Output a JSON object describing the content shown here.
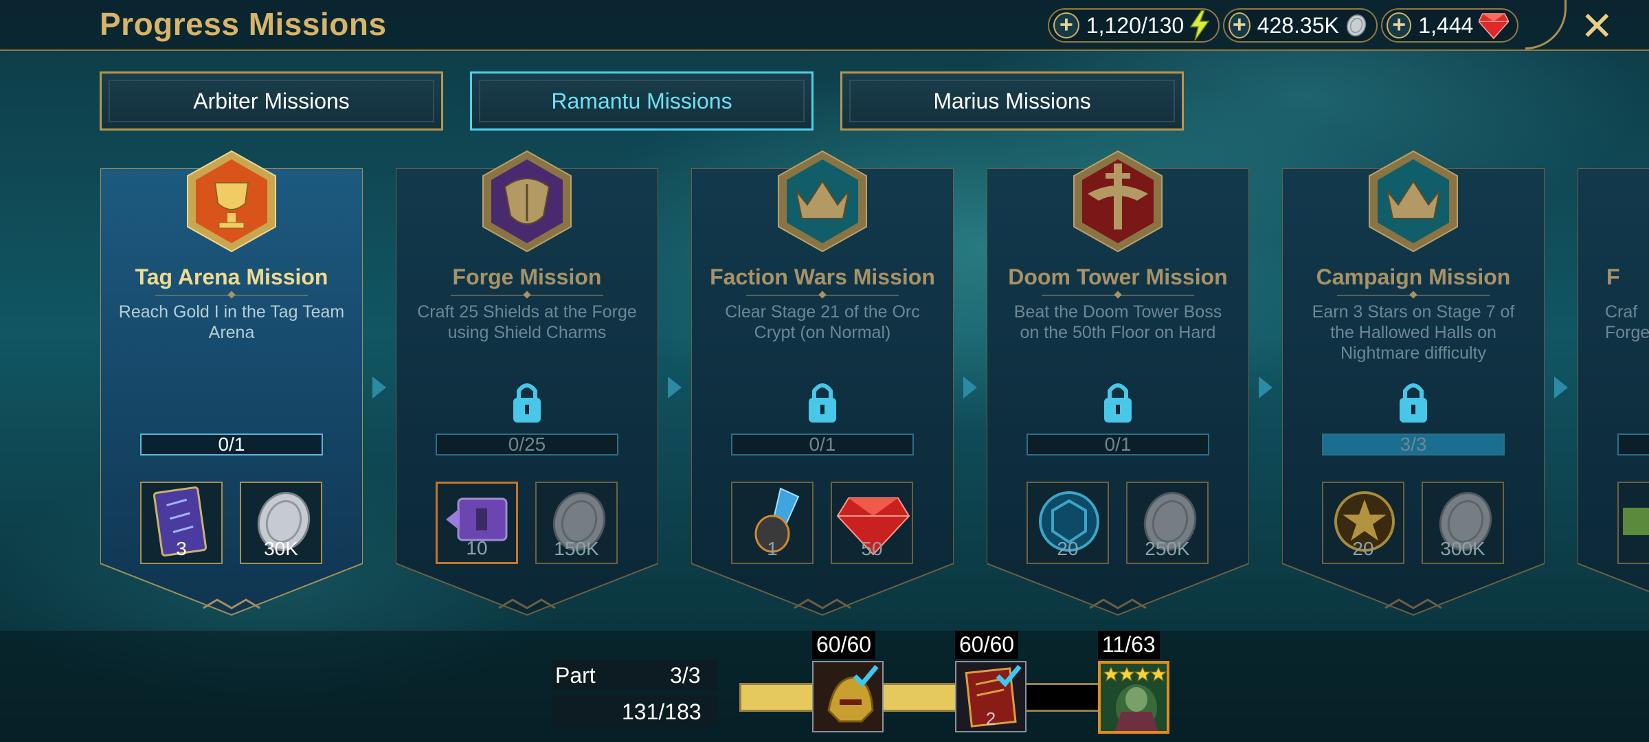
{
  "header": {
    "title": "Progress Missions",
    "currencies": [
      {
        "value": "1,120/130",
        "icon": "energy-icon"
      },
      {
        "value": "428.35K",
        "icon": "silver-icon"
      },
      {
        "value": "1,444",
        "icon": "gem-icon"
      }
    ],
    "close_icon": "close-icon"
  },
  "tabs": [
    {
      "label": "Arbiter Missions",
      "active": false
    },
    {
      "label": "Ramantu Missions",
      "active": true
    },
    {
      "label": "Marius Missions",
      "active": false
    }
  ],
  "missions": [
    {
      "title": "Tag Arena Mission",
      "desc": "Reach Gold I in the Tag Team Arena",
      "progress": "0/1",
      "fill": 0,
      "locked": false,
      "active": true,
      "rewards": [
        {
          "icon": "tome-icon",
          "qty": "3"
        },
        {
          "icon": "silver-icon",
          "qty": "30K"
        }
      ]
    },
    {
      "title": "Forge Mission",
      "desc": "Craft 25 Shields at the Forge using Shield Charms",
      "progress": "0/25",
      "fill": 0,
      "locked": true,
      "active": false,
      "rewards": [
        {
          "icon": "shield-artifact-icon",
          "qty": "10"
        },
        {
          "icon": "silver-icon",
          "qty": "150K"
        }
      ]
    },
    {
      "title": "Faction Wars Mission",
      "desc": "Clear Stage 21 of the Orc Crypt (on Normal)",
      "progress": "0/1",
      "fill": 0,
      "locked": true,
      "active": false,
      "rewards": [
        {
          "icon": "crystal-helmet-icon",
          "qty": "1"
        },
        {
          "icon": "gem-icon",
          "qty": "50"
        }
      ]
    },
    {
      "title": "Doom Tower Mission",
      "desc": "Beat the Doom Tower Boss on the 50th Floor on Hard",
      "progress": "0/1",
      "fill": 0,
      "locked": true,
      "active": false,
      "rewards": [
        {
          "icon": "doom-key-icon",
          "qty": "20"
        },
        {
          "icon": "silver-icon",
          "qty": "250K"
        }
      ]
    },
    {
      "title": "Campaign Mission",
      "desc": "Earn 3 Stars on Stage 7 of the Hallowed Halls on Nightmare difficulty",
      "progress": "3/3",
      "fill": 1,
      "locked": true,
      "active": false,
      "rewards": [
        {
          "icon": "star-token-icon",
          "qty": "20"
        },
        {
          "icon": "silver-icon",
          "qty": "300K"
        }
      ]
    },
    {
      "title": "F",
      "desc": "Craf Forge",
      "progress": "",
      "fill": 0,
      "locked": true,
      "active": false,
      "rewards": []
    }
  ],
  "footer": {
    "part_label": "Part",
    "part_value": "3/3",
    "points": "131/183",
    "overall_progress": 0.72,
    "milestones": [
      {
        "count": "60/60",
        "icon": "helmet-artifact-icon",
        "qty": "",
        "claimed": true
      },
      {
        "count": "60/60",
        "icon": "book-icon",
        "qty": "2",
        "claimed": true
      },
      {
        "count": "11/63",
        "icon": "champion-portrait-icon",
        "qty": "",
        "claimed": false
      }
    ]
  },
  "colors": {
    "gold": "#d8b469",
    "accent": "#4fd1ea",
    "bar_fill": "#e6c95c"
  }
}
